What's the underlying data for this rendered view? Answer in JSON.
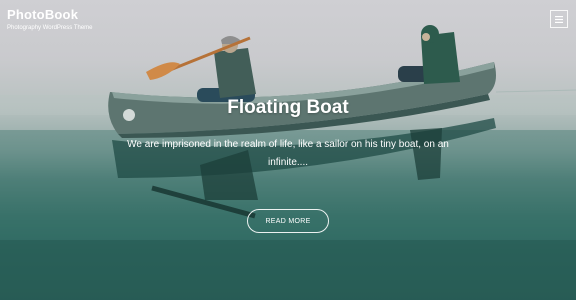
{
  "site": {
    "title": "PhotoBook",
    "tagline": "Photography WordPress Theme"
  },
  "header": {
    "menu_icon": "hamburger-menu-icon"
  },
  "hero": {
    "post_title": "Floating Boat",
    "excerpt": "We are imprisoned in the realm of life, like a sailor on his tiny boat, on an infinite....",
    "read_more_label": "READ MORE"
  },
  "colors": {
    "text": "#ffffff",
    "water": "#2f6962",
    "fog": "#cfcfd3",
    "canoe": "#56706a",
    "jacket_left": "#3c5b52",
    "jacket_right": "#2e5a4b"
  }
}
